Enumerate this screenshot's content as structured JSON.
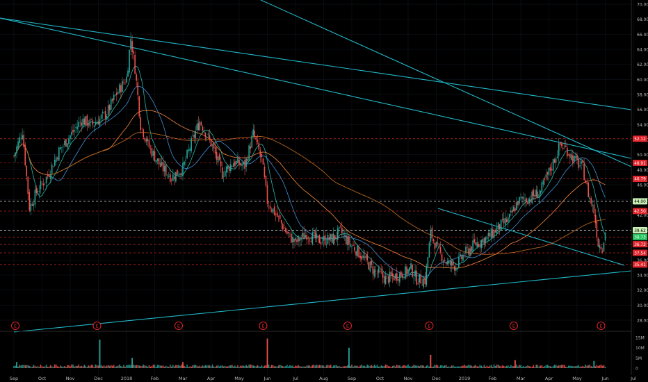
{
  "chart_data": [
    {
      "type": "candlestick",
      "panel": "price",
      "y_ticks": [
        "70.00",
        "68.00",
        "66.00",
        "64.00",
        "62.00",
        "60.00",
        "58.00",
        "56.00",
        "54.00",
        "52.00",
        "50.00",
        "48.00",
        "46.00",
        "44.00",
        "42.00",
        "40.00",
        "38.00",
        "36.00",
        "34.00",
        "32.00",
        "30.00",
        "28.00"
      ],
      "ylim": [
        27.5,
        70.6
      ],
      "price_labels": [
        {
          "text": "52.12",
          "value": 52.12,
          "color": "#e0242b"
        },
        {
          "text": "48.91",
          "value": 48.91,
          "color": "#e0242b"
        },
        {
          "text": "46.79",
          "value": 46.79,
          "color": "#e0242b"
        },
        {
          "text": "44.00",
          "value": 43.8,
          "color": "#c9f0b5"
        },
        {
          "text": "42.50",
          "value": 42.5,
          "color": "#e0242b"
        },
        {
          "text": "39.62",
          "value": 39.95,
          "color": "#c9f0b5"
        },
        {
          "text": "38.73",
          "value": 39.05,
          "color": "#22c55e"
        },
        {
          "text": "36.72",
          "value": 38.1,
          "color": "#e0242b"
        },
        {
          "text": "37.54",
          "value": 36.95,
          "color": "#e0242b"
        },
        {
          "text": "35.41",
          "value": 35.4,
          "color": "#e0242b"
        }
      ],
      "earnings_markers": [
        {
          "label": "E",
          "month_index": 0.1
        },
        {
          "label": "E",
          "month_index": 3.0
        },
        {
          "label": "E",
          "month_index": 5.9
        },
        {
          "label": "E",
          "month_index": 8.9
        },
        {
          "label": "E",
          "month_index": 11.9
        },
        {
          "label": "E",
          "month_index": 14.8
        },
        {
          "label": "E",
          "month_index": 17.8
        },
        {
          "label": "E",
          "month_index": 20.9
        }
      ],
      "price_path": [
        [
          0.0,
          49.8
        ],
        [
          0.3,
          53.2
        ],
        [
          0.55,
          43.0
        ],
        [
          0.8,
          45.0
        ],
        [
          1.2,
          47.2
        ],
        [
          1.6,
          50.5
        ],
        [
          2.0,
          52.5
        ],
        [
          2.4,
          54.6
        ],
        [
          2.8,
          54.0
        ],
        [
          3.3,
          55.5
        ],
        [
          3.6,
          57.8
        ],
        [
          4.0,
          60.2
        ],
        [
          4.15,
          65.5
        ],
        [
          4.3,
          61.5
        ],
        [
          4.5,
          54.0
        ],
        [
          4.8,
          51.0
        ],
        [
          5.2,
          48.5
        ],
        [
          5.6,
          47.0
        ],
        [
          6.0,
          48.2
        ],
        [
          6.3,
          51.5
        ],
        [
          6.6,
          54.5
        ],
        [
          7.0,
          51.5
        ],
        [
          7.4,
          47.5
        ],
        [
          7.8,
          49.0
        ],
        [
          8.2,
          48.5
        ],
        [
          8.5,
          52.8
        ],
        [
          8.8,
          49.3
        ],
        [
          9.0,
          43.8
        ],
        [
          9.4,
          41.5
        ],
        [
          9.7,
          39.5
        ],
        [
          10.0,
          38.3
        ],
        [
          10.4,
          39.5
        ],
        [
          10.8,
          38.6
        ],
        [
          11.3,
          38.8
        ],
        [
          11.6,
          39.8
        ],
        [
          11.9,
          38.2
        ],
        [
          12.1,
          37.6
        ],
        [
          12.4,
          36.3
        ],
        [
          12.8,
          34.5
        ],
        [
          13.2,
          33.5
        ],
        [
          13.5,
          33.8
        ],
        [
          13.8,
          34.2
        ],
        [
          14.1,
          34.8
        ],
        [
          14.3,
          33.5
        ],
        [
          14.6,
          33.3
        ],
        [
          14.8,
          39.5
        ],
        [
          15.1,
          37.0
        ],
        [
          15.4,
          35.5
        ],
        [
          15.7,
          35.2
        ],
        [
          16.0,
          36.8
        ],
        [
          16.4,
          38.2
        ],
        [
          16.8,
          38.9
        ],
        [
          17.2,
          40.3
        ],
        [
          17.6,
          41.5
        ],
        [
          17.9,
          43.8
        ],
        [
          18.3,
          44.2
        ],
        [
          18.7,
          45.1
        ],
        [
          19.1,
          48.5
        ],
        [
          19.4,
          51.3
        ],
        [
          19.6,
          50.8
        ],
        [
          19.9,
          49.3
        ],
        [
          20.2,
          48.2
        ],
        [
          20.4,
          44.8
        ],
        [
          20.6,
          42.5
        ],
        [
          20.75,
          38.2
        ],
        [
          20.9,
          37.8
        ],
        [
          21.0,
          39.6
        ]
      ],
      "x_ticks": [
        "Sep",
        "Oct",
        "Nov",
        "Dec",
        "2018",
        "Feb",
        "Mar",
        "Apr",
        "May",
        "Jun",
        "Jul",
        "Aug",
        "Sep",
        "Oct",
        "Nov",
        "Dec",
        "2019",
        "Feb",
        "Mar",
        "Apr",
        "May",
        "Jun",
        "Jul"
      ]
    },
    {
      "type": "bar",
      "panel": "volume",
      "y_ticks": [
        "15M",
        "10M",
        "5M",
        "0"
      ],
      "ylim": [
        0,
        17.5
      ],
      "spikes": [
        {
          "month_index": 3.05,
          "value": 14.0
        },
        {
          "month_index": 9.0,
          "value": 14.5
        },
        {
          "month_index": 11.9,
          "value": 10.0
        },
        {
          "month_index": 14.8,
          "value": 6.5
        },
        {
          "month_index": 4.2,
          "value": 5.0
        },
        {
          "month_index": 17.8,
          "value": 4.0
        },
        {
          "month_index": 20.6,
          "value": 3.5
        },
        {
          "month_index": 6.0,
          "value": 3.0
        },
        {
          "month_index": 0.1,
          "value": 3.0
        }
      ],
      "x_ticks": [
        "Sep",
        "Oct",
        "Nov",
        "Dec",
        "2018",
        "Feb",
        "Mar",
        "Apr",
        "May",
        "Jun",
        "Jul",
        "Aug",
        "Sep",
        "Oct",
        "Nov",
        "Dec",
        "2019",
        "Feb",
        "Mar",
        "Apr",
        "May",
        "Jun",
        "Jul"
      ]
    }
  ],
  "colors": {
    "background": "#000000",
    "up": "#26a69a",
    "up_bright": "#22c55e",
    "down": "#ef5350",
    "trendline": "#22b8c8",
    "ma_fast": "#26a69a",
    "ma_mid": "#3b82c4",
    "ma_slow": "#e07b39",
    "ma_long": "#b5651d",
    "marker": "#e0242b",
    "axis_text": "#b8b8b8",
    "grid": "#1e2a3a"
  }
}
